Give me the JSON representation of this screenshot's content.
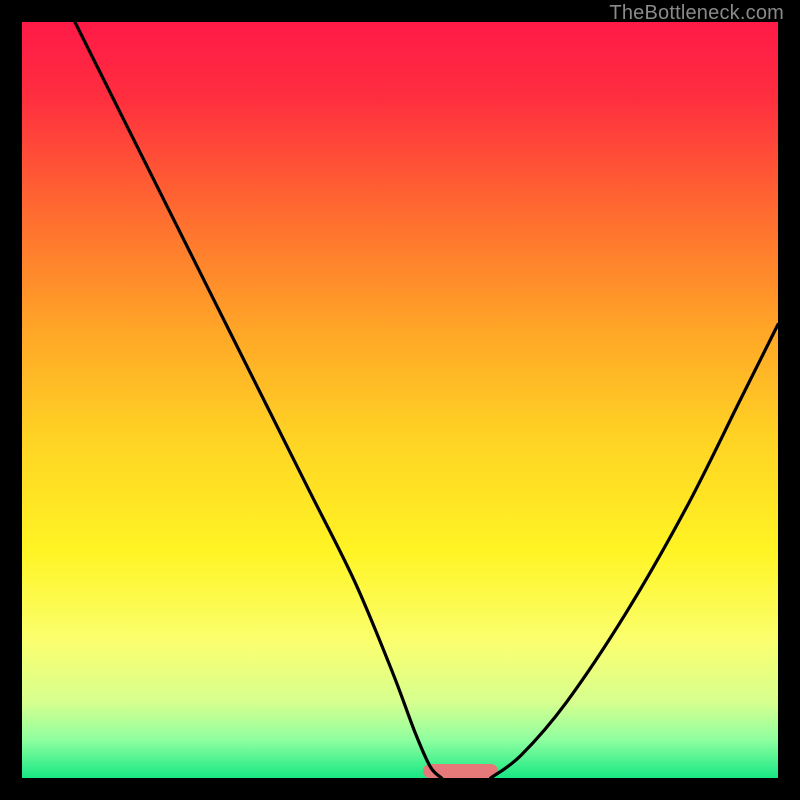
{
  "watermark": "TheBottleneck.com",
  "chart_data": {
    "type": "line",
    "title": "",
    "xlabel": "",
    "ylabel": "",
    "xlim": [
      0,
      100
    ],
    "ylim": [
      0,
      100
    ],
    "gradient_stops": [
      {
        "offset": 0.0,
        "color": "#ff1a47"
      },
      {
        "offset": 0.1,
        "color": "#ff2e3f"
      },
      {
        "offset": 0.25,
        "color": "#ff6a30"
      },
      {
        "offset": 0.4,
        "color": "#ffa327"
      },
      {
        "offset": 0.55,
        "color": "#ffd324"
      },
      {
        "offset": 0.7,
        "color": "#fff424"
      },
      {
        "offset": 0.82,
        "color": "#fbff6f"
      },
      {
        "offset": 0.9,
        "color": "#d6ff8f"
      },
      {
        "offset": 0.95,
        "color": "#8effa0"
      },
      {
        "offset": 1.0,
        "color": "#17e884"
      }
    ],
    "series": [
      {
        "name": "left-branch",
        "x": [
          7,
          12,
          18,
          25,
          32,
          38,
          44,
          49,
          52,
          54,
          55.5
        ],
        "values": [
          100,
          90,
          78,
          64,
          50,
          38,
          26,
          14,
          6,
          1.5,
          0
        ]
      },
      {
        "name": "right-branch",
        "x": [
          62,
          66,
          72,
          80,
          88,
          95,
          100
        ],
        "values": [
          0,
          3,
          10,
          22,
          36,
          50,
          60
        ]
      }
    ],
    "marker": {
      "x_start": 53,
      "x_end": 63,
      "y": 0
    }
  }
}
